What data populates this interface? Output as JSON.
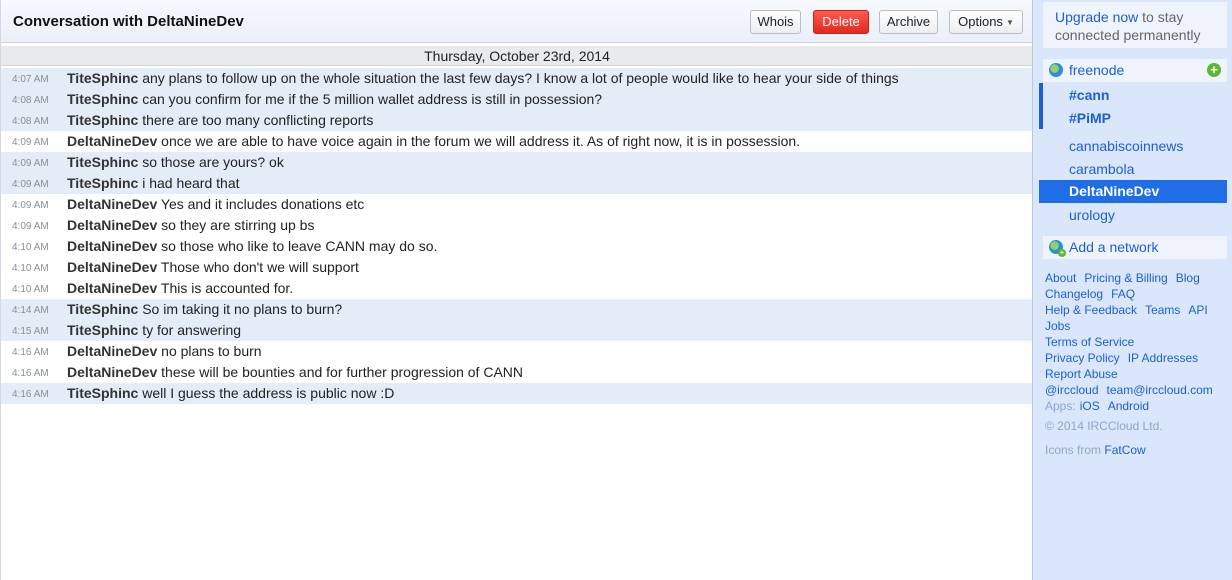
{
  "header": {
    "title": "Conversation with DeltaNineDev",
    "buttons": {
      "whois": "Whois",
      "delete": "Delete",
      "archive": "Archive",
      "options": "Options"
    }
  },
  "date_separator": "Thursday, October 23rd, 2014",
  "messages": [
    {
      "time": "4:07 AM",
      "nick": "TiteSphinc",
      "text": "any plans to follow up on the whole situation the last few days? I know a lot of people would like to hear your side of things"
    },
    {
      "time": "4:08 AM",
      "nick": "TiteSphinc",
      "text": "can you confirm for me if the 5 million wallet address is still in possession?"
    },
    {
      "time": "4:08 AM",
      "nick": "TiteSphinc",
      "text": "there are too many conflicting reports"
    },
    {
      "time": "4:09 AM",
      "nick": "DeltaNineDev",
      "text": "once we are able to have voice again in the forum we will address it.  As of right now, it is in possession."
    },
    {
      "time": "4:09 AM",
      "nick": "TiteSphinc",
      "text": "so those are yours? ok"
    },
    {
      "time": "4:09 AM",
      "nick": "TiteSphinc",
      "text": "i had heard that"
    },
    {
      "time": "4:09 AM",
      "nick": "DeltaNineDev",
      "text": "Yes and it includes donations etc"
    },
    {
      "time": "4:09 AM",
      "nick": "DeltaNineDev",
      "text": "so they are stirring up bs"
    },
    {
      "time": "4:10 AM",
      "nick": "DeltaNineDev",
      "text": "so those who like to leave CANN may do so."
    },
    {
      "time": "4:10 AM",
      "nick": "DeltaNineDev",
      "text": "Those who don't we will support"
    },
    {
      "time": "4:10 AM",
      "nick": "DeltaNineDev",
      "text": "This is accounted for."
    },
    {
      "time": "4:14 AM",
      "nick": "TiteSphinc",
      "text": "So im taking it no plans to burn?"
    },
    {
      "time": "4:15 AM",
      "nick": "TiteSphinc",
      "text": "ty for answering"
    },
    {
      "time": "4:16 AM",
      "nick": "DeltaNineDev",
      "text": "no plans to burn"
    },
    {
      "time": "4:16 AM",
      "nick": "DeltaNineDev",
      "text": "these will be bounties and for further progression of CANN"
    },
    {
      "time": "4:16 AM",
      "nick": "TiteSphinc",
      "text": "well I guess the address is public now :D"
    }
  ],
  "sidebar": {
    "upgrade": {
      "link": "Upgrade now",
      "rest": "to stay connected permanently"
    },
    "network": "freenode",
    "channels": [
      "#cann",
      "#PiMP"
    ],
    "queries": [
      "cannabiscoinnews",
      "carambola",
      "DeltaNineDev",
      "urology"
    ],
    "selected_query": "DeltaNineDev",
    "add_network": "Add a network",
    "footer": {
      "row1": [
        "About",
        "Pricing & Billing",
        "Blog"
      ],
      "row2": [
        "Changelog",
        "FAQ"
      ],
      "row3": [
        "Help & Feedback",
        "Teams",
        "API"
      ],
      "row4": [
        "Jobs"
      ],
      "row5": [
        "Terms of Service"
      ],
      "row6": [
        "Privacy Policy",
        "IP Addresses"
      ],
      "row7": [
        "Report Abuse"
      ],
      "row8": [
        "@irccloud",
        "team@irccloud.com"
      ],
      "apps_label": "Apps:",
      "apps": [
        "iOS",
        "Android"
      ],
      "copyright": "© 2014 IRCCloud Ltd.",
      "icons_prefix": "Icons from",
      "icons_link": "FatCow"
    }
  },
  "colors": {
    "accent": "#1f5fd1",
    "highlight_row": "#e4ecf8",
    "sidebar_bg": "#dae6fa",
    "delete_button": "#e02a20",
    "selected_query_bg": "#1f6ee8"
  }
}
